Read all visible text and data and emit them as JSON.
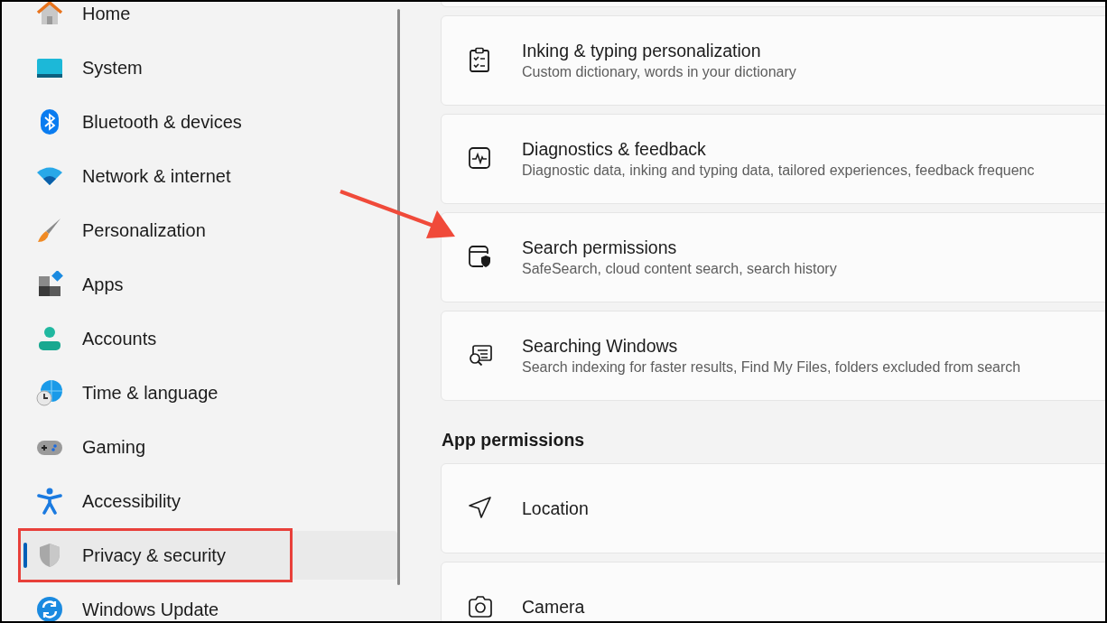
{
  "sidebar": {
    "items": [
      {
        "label": "Home",
        "selected": false,
        "annotated": false
      },
      {
        "label": "System",
        "selected": false,
        "annotated": false
      },
      {
        "label": "Bluetooth & devices",
        "selected": false,
        "annotated": false
      },
      {
        "label": "Network & internet",
        "selected": false,
        "annotated": false
      },
      {
        "label": "Personalization",
        "selected": false,
        "annotated": false
      },
      {
        "label": "Apps",
        "selected": false,
        "annotated": false
      },
      {
        "label": "Accounts",
        "selected": false,
        "annotated": false
      },
      {
        "label": "Time & language",
        "selected": false,
        "annotated": false
      },
      {
        "label": "Gaming",
        "selected": false,
        "annotated": false
      },
      {
        "label": "Accessibility",
        "selected": false,
        "annotated": false
      },
      {
        "label": "Privacy & security",
        "selected": true,
        "annotated": true
      },
      {
        "label": "Windows Update",
        "selected": false,
        "annotated": false
      }
    ]
  },
  "content": {
    "cards": [
      {
        "title": "Inking & typing personalization",
        "subtitle": "Custom dictionary, words in your dictionary",
        "annotated": false
      },
      {
        "title": "Diagnostics & feedback",
        "subtitle": "Diagnostic data, inking and typing data, tailored experiences, feedback frequenc",
        "annotated": false
      },
      {
        "title": "Search permissions",
        "subtitle": "SafeSearch, cloud content search, search history",
        "annotated": true
      },
      {
        "title": "Searching Windows",
        "subtitle": "Search indexing for faster results, Find My Files, folders excluded from search",
        "annotated": false
      }
    ],
    "section_heading": "App permissions",
    "permission_cards": [
      {
        "title": "Location"
      },
      {
        "title": "Camera"
      }
    ]
  }
}
